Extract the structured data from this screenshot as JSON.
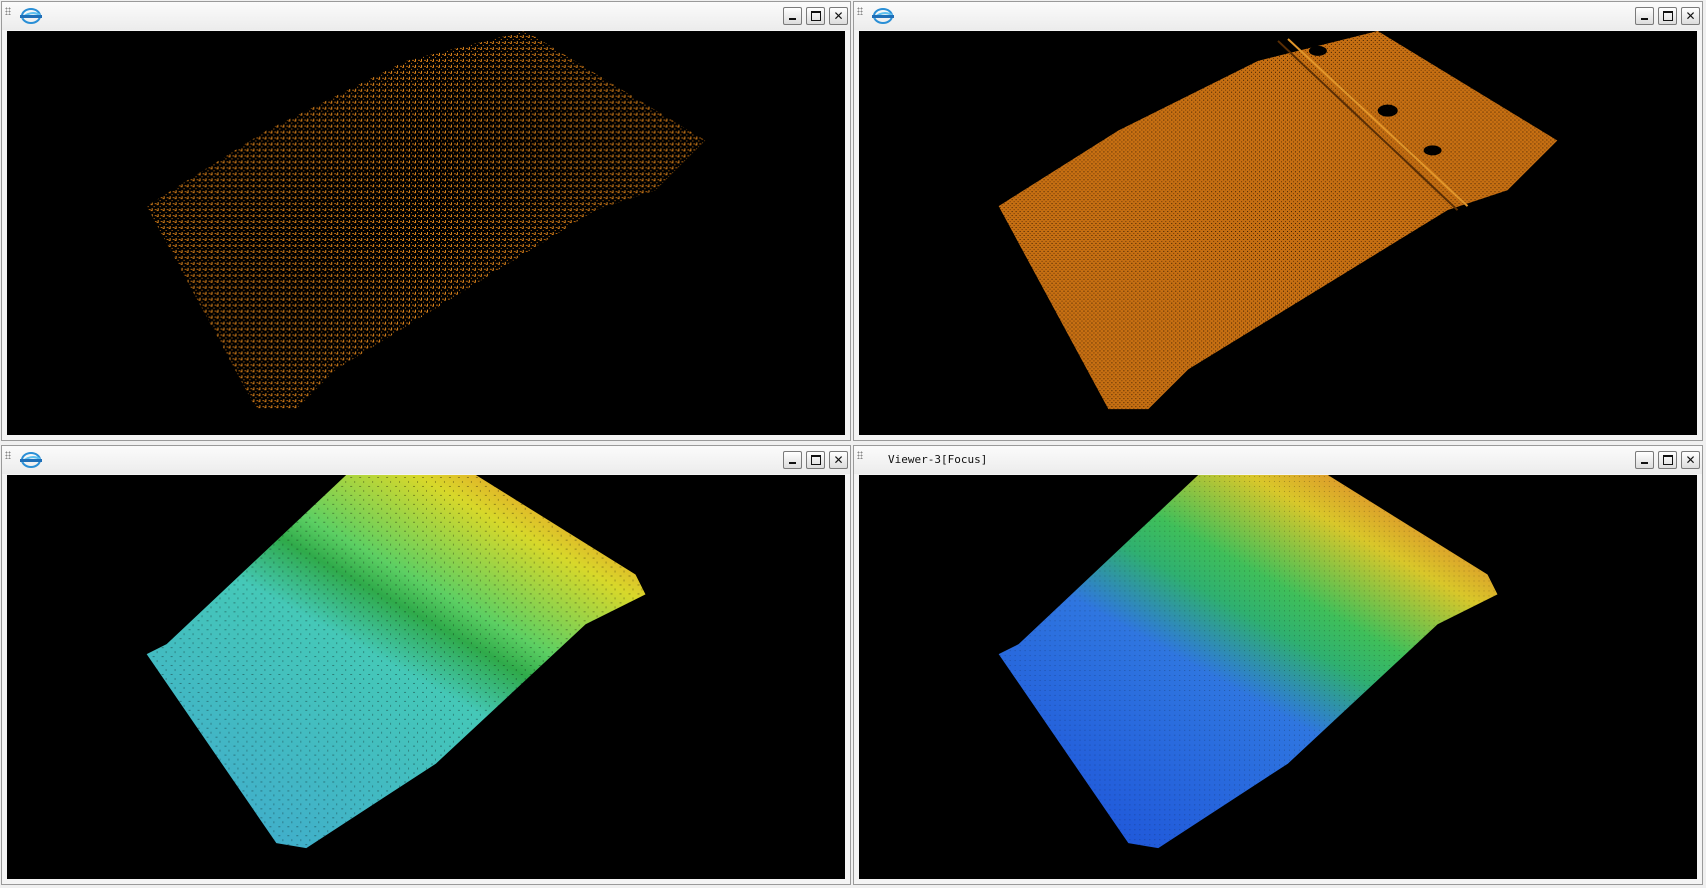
{
  "viewers": [
    {
      "title": "",
      "maximize_label": "",
      "close_label": "✕",
      "render_mode": "sparse point cloud",
      "point_color": "#d27a16"
    },
    {
      "title": "",
      "maximize_label": "",
      "close_label": "✕",
      "render_mode": "dense point cloud",
      "point_color": "#c66f12"
    },
    {
      "title": "",
      "maximize_label": "",
      "close_label": "✕",
      "render_mode": "elevation colored surface",
      "colors": [
        "#3fa7d0",
        "#45c8b8",
        "#5ccf63",
        "#d8d82a",
        "#e8a028"
      ]
    },
    {
      "title": "Viewer-3[Focus]",
      "maximize_label": "",
      "close_label": "✕",
      "render_mode": "elevation colored surface",
      "colors": [
        "#1b4fd8",
        "#2f76e0",
        "#3fbf5a",
        "#d9c72a",
        "#e0892a"
      ]
    }
  ],
  "icons": {
    "logo": "company-logo-icon",
    "minimize": "minimize-icon",
    "maximize": "maximize-icon",
    "close": "close-icon"
  }
}
